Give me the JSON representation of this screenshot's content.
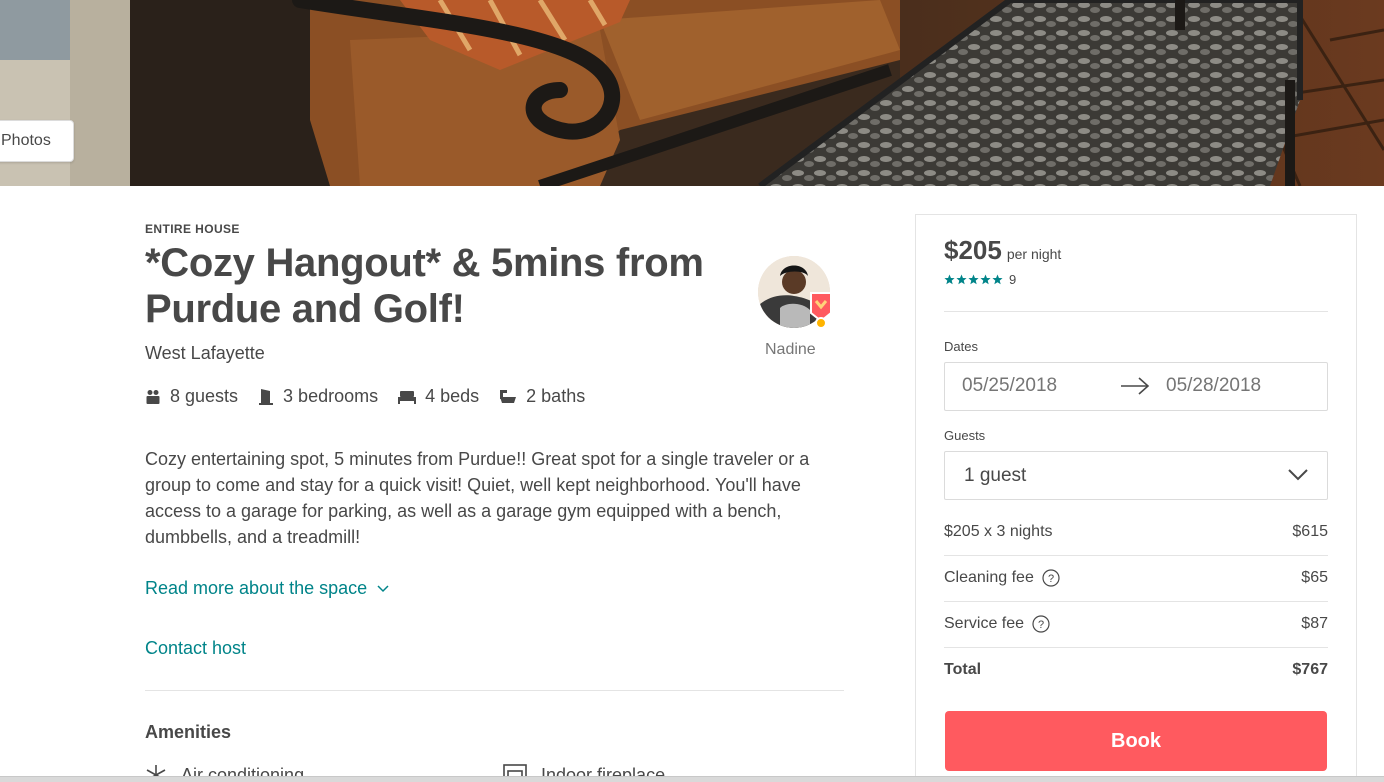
{
  "hero": {
    "photos_button_label": "Photos"
  },
  "listing": {
    "kicker": "ENTIRE HOUSE",
    "title": "*Cozy Hangout* & 5mins from Purdue and Golf!",
    "city": "West Lafayette",
    "host_name": "Nadine",
    "facts": [
      {
        "icon": "guests-icon",
        "label": "8 guests"
      },
      {
        "icon": "bedrooms-icon",
        "label": "3 bedrooms"
      },
      {
        "icon": "beds-icon",
        "label": "4 beds"
      },
      {
        "icon": "baths-icon",
        "label": "2 baths"
      }
    ],
    "description": "Cozy entertaining spot, 5 minutes from Purdue!! Great spot for a single traveler or a group to come and stay for a quick visit! Quiet, well kept neighborhood. You'll have access to a garage for parking, as well as a garage gym equipped with a bench, dumbbells, and a treadmill!",
    "read_more_label": "Read more about the space",
    "contact_host_label": "Contact host",
    "amenities_title": "Amenities",
    "amenities": [
      {
        "icon": "snowflake-icon",
        "label": "Air conditioning"
      },
      {
        "icon": "fireplace-icon",
        "label": "Indoor fireplace"
      }
    ]
  },
  "booking": {
    "price": "$205",
    "price_unit": "per night",
    "rating_stars": 5,
    "review_count": "9",
    "dates_label": "Dates",
    "check_in": "05/25/2018",
    "check_out": "05/28/2018",
    "guests_label": "Guests",
    "guests_value": "1 guest",
    "line_items": [
      {
        "label": "$205 x 3 nights",
        "amount": "$615"
      },
      {
        "label": "Cleaning fee",
        "amount": "$65"
      },
      {
        "label": "Service fee",
        "amount": "$87"
      },
      {
        "label": "Total",
        "amount": "$767"
      }
    ],
    "book_label": "Book"
  },
  "colors": {
    "accent_teal": "#008489",
    "book_red": "#ff5a5f",
    "text": "#484848",
    "muted": "#767676"
  }
}
